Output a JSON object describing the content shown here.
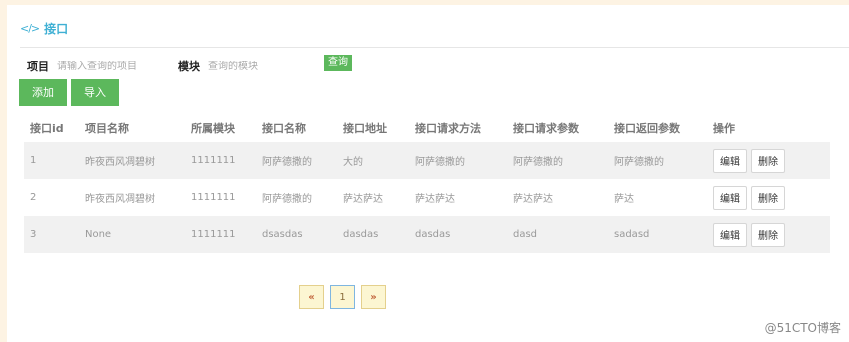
{
  "header": {
    "icon": "code-icon",
    "title": "接口"
  },
  "filters": {
    "project_label": "项目",
    "project_placeholder": "请输入查询的项目",
    "module_label": "模块",
    "module_placeholder": "查询的模块",
    "query_label": "查询"
  },
  "actions": {
    "add_label": "添加",
    "import_label": "导入"
  },
  "table": {
    "columns": [
      "接口id",
      "项目名称",
      "所属模块",
      "接口名称",
      "接口地址",
      "接口请求方法",
      "接口请求参数",
      "接口返回参数",
      "操作"
    ],
    "rows": [
      [
        "1",
        "昨夜西风凋碧树",
        "1111111",
        "阿萨德撒的",
        "大的",
        "阿萨德撒的",
        "阿萨德撒的",
        "阿萨德撒的"
      ],
      [
        "2",
        "昨夜西风凋碧树",
        "1111111",
        "阿萨德撒的",
        "萨达萨达",
        "萨达萨达",
        "萨达萨达",
        "萨达"
      ],
      [
        "3",
        "None",
        "1111111",
        "dsasdas",
        "dasdas",
        "dasdas",
        "dasd",
        "sadasd"
      ]
    ],
    "edit_label": "编辑",
    "delete_label": "删除"
  },
  "pager": {
    "prev": "«",
    "current": "1",
    "next": "»"
  },
  "watermark": "@51CTO博客",
  "colors": {
    "accent": "#3fb0d4",
    "button_green": "#5cb85c"
  }
}
